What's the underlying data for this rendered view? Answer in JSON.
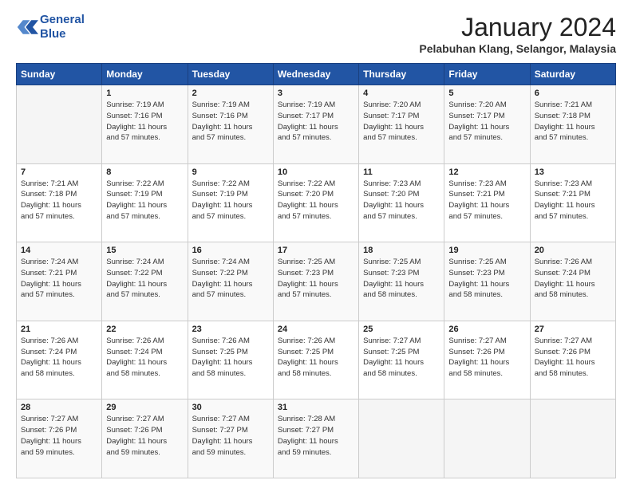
{
  "logo": {
    "line1": "General",
    "line2": "Blue"
  },
  "title": "January 2024",
  "subtitle": "Pelabuhan Klang, Selangor, Malaysia",
  "header_days": [
    "Sunday",
    "Monday",
    "Tuesday",
    "Wednesday",
    "Thursday",
    "Friday",
    "Saturday"
  ],
  "weeks": [
    [
      {
        "day": "",
        "info": ""
      },
      {
        "day": "1",
        "info": "Sunrise: 7:19 AM\nSunset: 7:16 PM\nDaylight: 11 hours\nand 57 minutes."
      },
      {
        "day": "2",
        "info": "Sunrise: 7:19 AM\nSunset: 7:16 PM\nDaylight: 11 hours\nand 57 minutes."
      },
      {
        "day": "3",
        "info": "Sunrise: 7:19 AM\nSunset: 7:17 PM\nDaylight: 11 hours\nand 57 minutes."
      },
      {
        "day": "4",
        "info": "Sunrise: 7:20 AM\nSunset: 7:17 PM\nDaylight: 11 hours\nand 57 minutes."
      },
      {
        "day": "5",
        "info": "Sunrise: 7:20 AM\nSunset: 7:17 PM\nDaylight: 11 hours\nand 57 minutes."
      },
      {
        "day": "6",
        "info": "Sunrise: 7:21 AM\nSunset: 7:18 PM\nDaylight: 11 hours\nand 57 minutes."
      }
    ],
    [
      {
        "day": "7",
        "info": "Sunrise: 7:21 AM\nSunset: 7:18 PM\nDaylight: 11 hours\nand 57 minutes."
      },
      {
        "day": "8",
        "info": "Sunrise: 7:22 AM\nSunset: 7:19 PM\nDaylight: 11 hours\nand 57 minutes."
      },
      {
        "day": "9",
        "info": "Sunrise: 7:22 AM\nSunset: 7:19 PM\nDaylight: 11 hours\nand 57 minutes."
      },
      {
        "day": "10",
        "info": "Sunrise: 7:22 AM\nSunset: 7:20 PM\nDaylight: 11 hours\nand 57 minutes."
      },
      {
        "day": "11",
        "info": "Sunrise: 7:23 AM\nSunset: 7:20 PM\nDaylight: 11 hours\nand 57 minutes."
      },
      {
        "day": "12",
        "info": "Sunrise: 7:23 AM\nSunset: 7:21 PM\nDaylight: 11 hours\nand 57 minutes."
      },
      {
        "day": "13",
        "info": "Sunrise: 7:23 AM\nSunset: 7:21 PM\nDaylight: 11 hours\nand 57 minutes."
      }
    ],
    [
      {
        "day": "14",
        "info": "Sunrise: 7:24 AM\nSunset: 7:21 PM\nDaylight: 11 hours\nand 57 minutes."
      },
      {
        "day": "15",
        "info": "Sunrise: 7:24 AM\nSunset: 7:22 PM\nDaylight: 11 hours\nand 57 minutes."
      },
      {
        "day": "16",
        "info": "Sunrise: 7:24 AM\nSunset: 7:22 PM\nDaylight: 11 hours\nand 57 minutes."
      },
      {
        "day": "17",
        "info": "Sunrise: 7:25 AM\nSunset: 7:23 PM\nDaylight: 11 hours\nand 57 minutes."
      },
      {
        "day": "18",
        "info": "Sunrise: 7:25 AM\nSunset: 7:23 PM\nDaylight: 11 hours\nand 58 minutes."
      },
      {
        "day": "19",
        "info": "Sunrise: 7:25 AM\nSunset: 7:23 PM\nDaylight: 11 hours\nand 58 minutes."
      },
      {
        "day": "20",
        "info": "Sunrise: 7:26 AM\nSunset: 7:24 PM\nDaylight: 11 hours\nand 58 minutes."
      }
    ],
    [
      {
        "day": "21",
        "info": "Sunrise: 7:26 AM\nSunset: 7:24 PM\nDaylight: 11 hours\nand 58 minutes."
      },
      {
        "day": "22",
        "info": "Sunrise: 7:26 AM\nSunset: 7:24 PM\nDaylight: 11 hours\nand 58 minutes."
      },
      {
        "day": "23",
        "info": "Sunrise: 7:26 AM\nSunset: 7:25 PM\nDaylight: 11 hours\nand 58 minutes."
      },
      {
        "day": "24",
        "info": "Sunrise: 7:26 AM\nSunset: 7:25 PM\nDaylight: 11 hours\nand 58 minutes."
      },
      {
        "day": "25",
        "info": "Sunrise: 7:27 AM\nSunset: 7:25 PM\nDaylight: 11 hours\nand 58 minutes."
      },
      {
        "day": "26",
        "info": "Sunrise: 7:27 AM\nSunset: 7:26 PM\nDaylight: 11 hours\nand 58 minutes."
      },
      {
        "day": "27",
        "info": "Sunrise: 7:27 AM\nSunset: 7:26 PM\nDaylight: 11 hours\nand 58 minutes."
      }
    ],
    [
      {
        "day": "28",
        "info": "Sunrise: 7:27 AM\nSunset: 7:26 PM\nDaylight: 11 hours\nand 59 minutes."
      },
      {
        "day": "29",
        "info": "Sunrise: 7:27 AM\nSunset: 7:26 PM\nDaylight: 11 hours\nand 59 minutes."
      },
      {
        "day": "30",
        "info": "Sunrise: 7:27 AM\nSunset: 7:27 PM\nDaylight: 11 hours\nand 59 minutes."
      },
      {
        "day": "31",
        "info": "Sunrise: 7:28 AM\nSunset: 7:27 PM\nDaylight: 11 hours\nand 59 minutes."
      },
      {
        "day": "",
        "info": ""
      },
      {
        "day": "",
        "info": ""
      },
      {
        "day": "",
        "info": ""
      }
    ]
  ]
}
